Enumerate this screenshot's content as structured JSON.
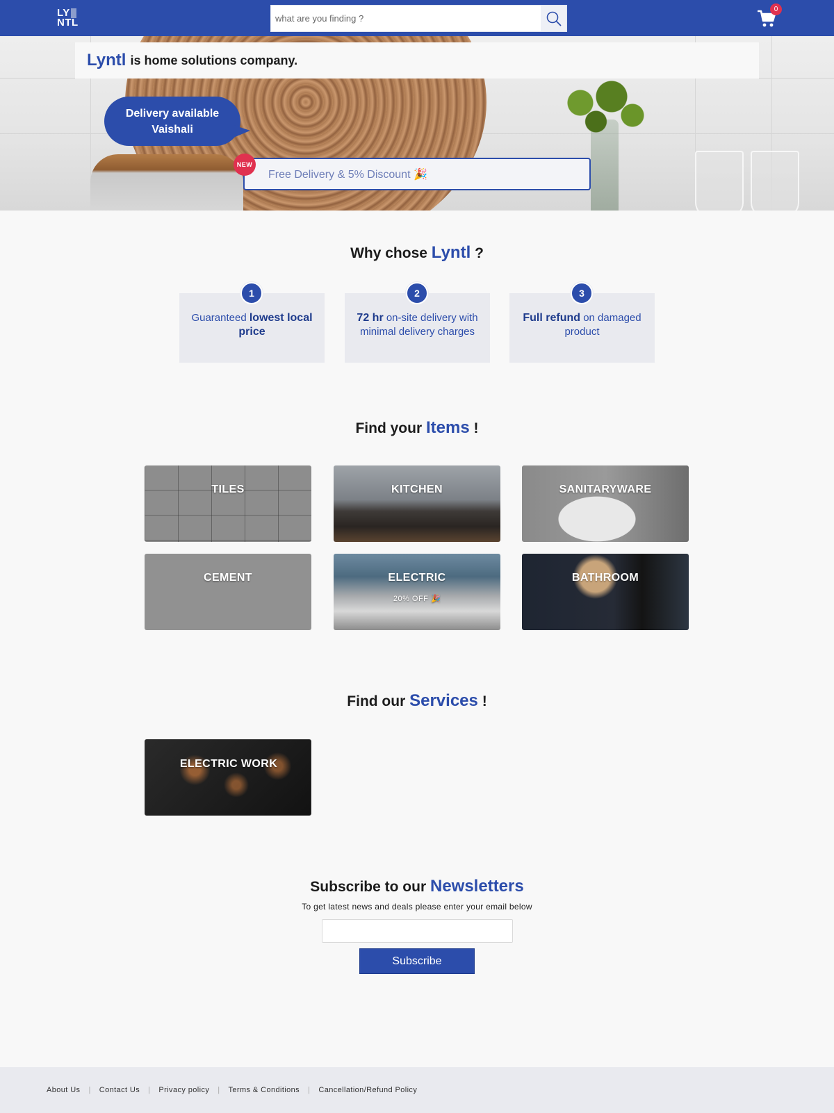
{
  "header": {
    "logo_line1": "LY",
    "logo_line2": "NTL",
    "search_placeholder": "what are you finding ?",
    "cart_count": "0",
    "icons": {
      "search": "search-icon",
      "cart": "cart-icon"
    },
    "colors": {
      "primary": "#2c4dab",
      "badge": "#e0314f"
    }
  },
  "hero": {
    "brand": "Lyntl",
    "tagline": "is home solutions company.",
    "delivery_line1": "Delivery available",
    "delivery_line2": "Vaishali",
    "new_badge": "NEW",
    "promo": "Free Delivery & 5% Discount 🎉"
  },
  "why": {
    "title_prefix": "Why chose",
    "title_accent": "Lyntl",
    "title_suffix": "?",
    "cards": [
      {
        "num": "1",
        "pre": "Guaranteed ",
        "strong": "lowest local price",
        "post": ""
      },
      {
        "num": "2",
        "pre": "",
        "strong": "72 hr",
        "post": " on-site delivery with minimal delivery charges"
      },
      {
        "num": "3",
        "pre": "",
        "strong": "Full refund",
        "post": " on damaged product"
      }
    ]
  },
  "items": {
    "title_prefix": "Find your",
    "title_accent": "Items",
    "title_suffix": "!",
    "tiles": [
      {
        "label": "TILES"
      },
      {
        "label": "KITCHEN"
      },
      {
        "label": "SANITARYWARE"
      },
      {
        "label": "CEMENT"
      },
      {
        "label": "ELECTRIC",
        "sub": "20% OFF 🎉"
      },
      {
        "label": "BATHROOM"
      }
    ]
  },
  "services": {
    "title_prefix": "Find our",
    "title_accent": "Services",
    "title_suffix": "!",
    "tiles": [
      {
        "label": "ELECTRIC WORK"
      }
    ]
  },
  "newsletter": {
    "title_prefix": "Subscribe to our",
    "title_accent": "Newsletters",
    "subtitle": "To get latest news and deals please enter your email below",
    "email_value": "",
    "button": "Subscribe"
  },
  "footer": {
    "links": [
      "About Us",
      "Contact Us",
      "Privacy policy",
      "Terms & Conditions",
      "Cancellation/Refund Policy"
    ],
    "separator": "|"
  }
}
